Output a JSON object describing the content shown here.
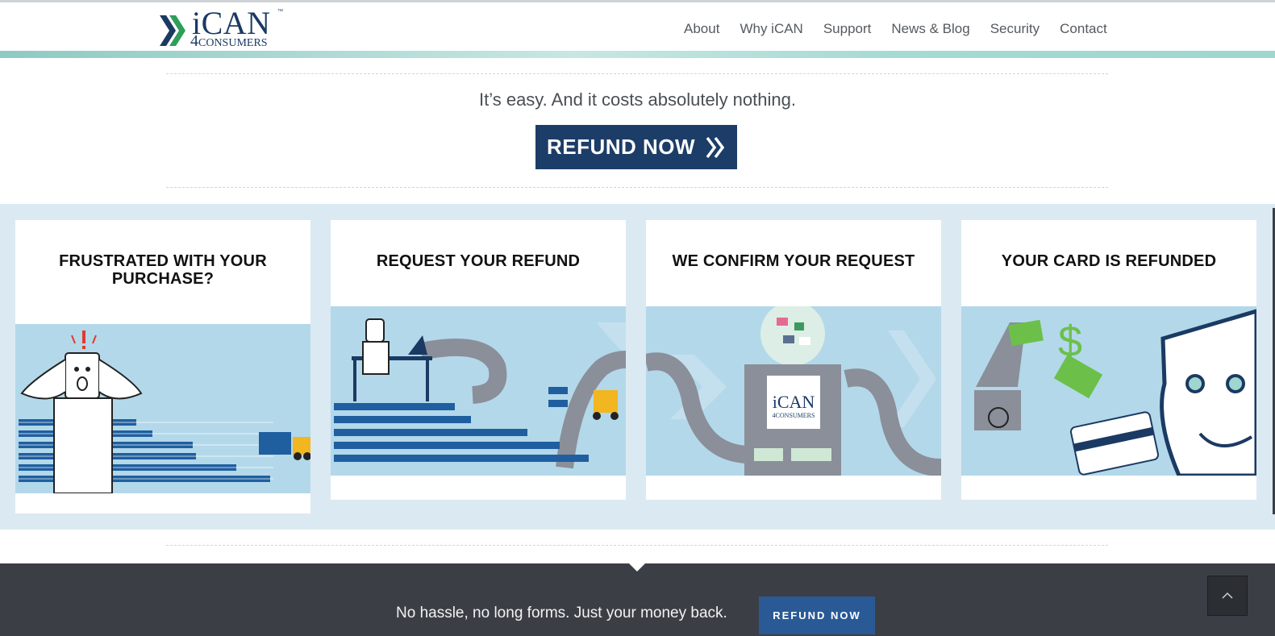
{
  "header": {
    "logo": {
      "word": "iCAN",
      "four": "4",
      "sub": "CONSUMERS",
      "tm": "™"
    },
    "nav": [
      "About",
      "Why iCAN",
      "Support",
      "News & Blog",
      "Security",
      "Contact"
    ]
  },
  "hero": {
    "tagline": "It’s easy. And it costs absolutely nothing.",
    "button": "REFUND NOW"
  },
  "steps": [
    {
      "title": "FRUSTRATED WITH YOUR PURCHASE?"
    },
    {
      "title": "REQUEST YOUR REFUND"
    },
    {
      "title": "WE CONFIRM YOUR REQUEST",
      "machine_logo": "iCAN",
      "machine_sub": "4CONSUMERS"
    },
    {
      "title": "YOUR CARD IS REFUNDED"
    }
  ],
  "footer": {
    "text": "No hassle, no long forms. Just your money back.",
    "button": "REFUND NOW"
  },
  "colors": {
    "brand_navy": "#1c3d67",
    "footer_bg": "#3b3f45",
    "band_bg": "#dbe9f2",
    "image_bg": "#b3d8ea",
    "accent_green": "#2e8b57"
  },
  "icons": [
    "chevron-logo-icon",
    "double-chevron-right-icon",
    "chevron-up-icon"
  ]
}
